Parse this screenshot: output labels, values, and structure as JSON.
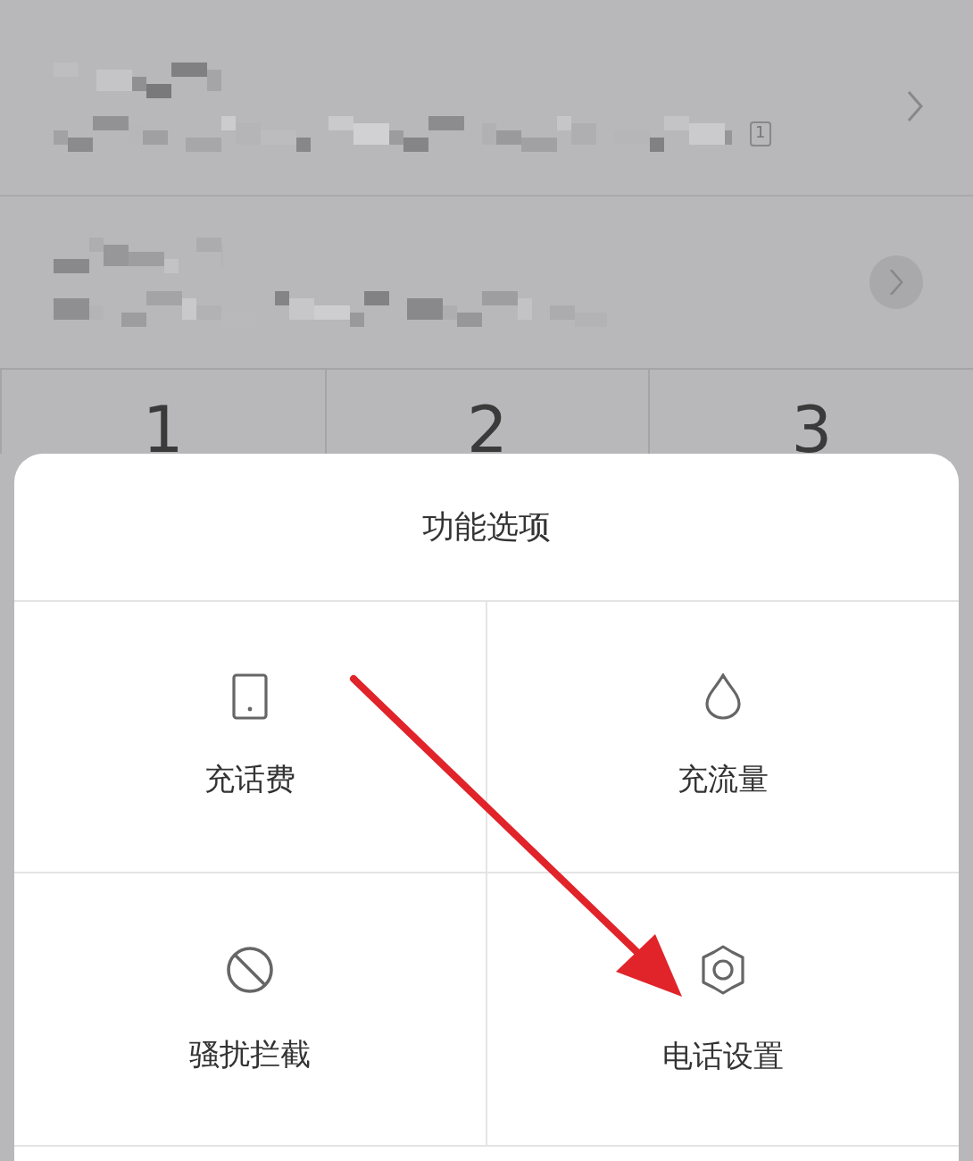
{
  "call_log": [
    {
      "kind": "plain",
      "sim_badge": "1"
    },
    {
      "kind": "circled"
    }
  ],
  "keypad": [
    "1",
    "2",
    "3"
  ],
  "sheet": {
    "title": "功能选项",
    "options": [
      {
        "kind": "phone",
        "label": "充话费"
      },
      {
        "kind": "drop",
        "label": "充流量"
      },
      {
        "kind": "block",
        "label": "骚扰拦截"
      },
      {
        "kind": "gear",
        "label": "电话设置"
      }
    ]
  },
  "annotation": {
    "kind": "arrow"
  }
}
